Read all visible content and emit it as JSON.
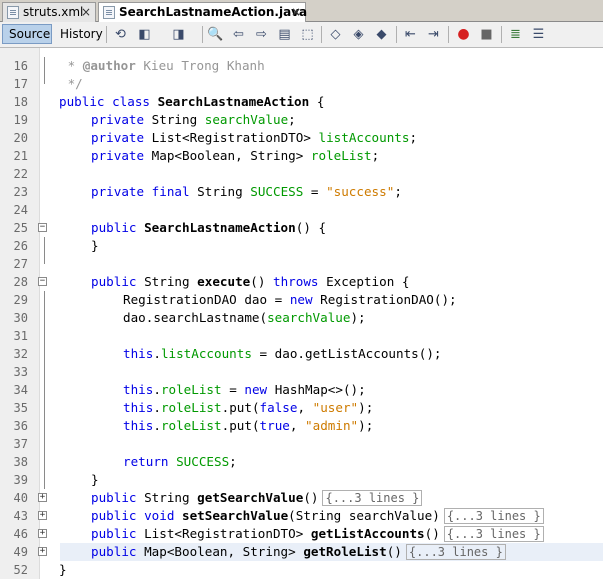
{
  "tabs": [
    {
      "label": "struts.xml",
      "close": "×",
      "active": false
    },
    {
      "label": "SearchLastnameAction.java",
      "close": "×",
      "active": true
    }
  ],
  "toolbar": {
    "source_label": "Source",
    "history_label": "History"
  },
  "colors": {
    "keyword": "#0000e6",
    "field": "#009900",
    "string": "#ce7b00",
    "comment": "#969696",
    "tab_active_bg": "#ffffff",
    "toolbar_active": "#b9d1ea"
  },
  "lines": [
    {
      "n": "16"
    },
    {
      "n": "17"
    },
    {
      "n": "18"
    },
    {
      "n": "19"
    },
    {
      "n": "20"
    },
    {
      "n": "21"
    },
    {
      "n": "22"
    },
    {
      "n": "23"
    },
    {
      "n": "24"
    },
    {
      "n": "25"
    },
    {
      "n": "26"
    },
    {
      "n": "27"
    },
    {
      "n": "28"
    },
    {
      "n": "29"
    },
    {
      "n": "30"
    },
    {
      "n": "31"
    },
    {
      "n": "32"
    },
    {
      "n": "33"
    },
    {
      "n": "34"
    },
    {
      "n": "35"
    },
    {
      "n": "36"
    },
    {
      "n": "37"
    },
    {
      "n": "38"
    },
    {
      "n": "39"
    },
    {
      "n": "40"
    },
    {
      "n": "43"
    },
    {
      "n": "46"
    },
    {
      "n": "49"
    },
    {
      "n": "52"
    }
  ],
  "code": {
    "l16": {
      "a": " * ",
      "b": "@author",
      "c": " Kieu Trong Khanh"
    },
    "l17": " */",
    "l18": {
      "kw": "public class ",
      "name": "SearchLastnameAction",
      "rest": " {"
    },
    "l19": {
      "kw": "private ",
      "type": "String ",
      "fld": "searchValue",
      "rest": ";"
    },
    "l20": {
      "kw": "private ",
      "type": "List<RegistrationDTO> ",
      "fld": "listAccounts",
      "rest": ";"
    },
    "l21": {
      "kw": "private ",
      "type": "Map<Boolean, String> ",
      "fld": "roleList",
      "rest": ";"
    },
    "l23": {
      "kw": "private final ",
      "type": "String ",
      "fld": "SUCCESS",
      "mid": " = ",
      "str": "\"success\"",
      "rest": ";"
    },
    "l25": {
      "kw": "public ",
      "name": "SearchLastnameAction",
      "rest": "() {"
    },
    "l26": "}",
    "l28": {
      "kw": "public ",
      "type": "String ",
      "name": "execute",
      "mid": "() ",
      "kw2": "throws ",
      "rest": "Exception {"
    },
    "l29": {
      "a": "RegistrationDAO dao = ",
      "kw": "new ",
      "rest": "RegistrationDAO();"
    },
    "l30": {
      "a": "dao.searchLastname(",
      "fld": "searchValue",
      "rest": ");"
    },
    "l32": {
      "kw": "this",
      "a": ".",
      "fld": "listAccounts",
      "rest": " = dao.getListAccounts();"
    },
    "l34": {
      "kw": "this",
      "a": ".",
      "fld": "roleList",
      "mid": " = ",
      "kw2": "new ",
      "rest": "HashMap<>();"
    },
    "l35": {
      "kw": "this",
      "a": ".",
      "fld": "roleList",
      "mid": ".put(",
      "kw2": "false",
      "sep": ", ",
      "str": "\"user\"",
      "rest": ");"
    },
    "l36": {
      "kw": "this",
      "a": ".",
      "fld": "roleList",
      "mid": ".put(",
      "kw2": "true",
      "sep": ", ",
      "str": "\"admin\"",
      "rest": ");"
    },
    "l38": {
      "kw": "return ",
      "fld": "SUCCESS",
      "rest": ";"
    },
    "l39": "}",
    "l40": {
      "kw": "public ",
      "type": "String ",
      "name": "getSearchValue",
      "rest": "()",
      "folded": "{...3 lines }"
    },
    "l43": {
      "kw": "public void ",
      "name": "setSearchValue",
      "rest": "(String searchValue)",
      "folded": "{...3 lines }"
    },
    "l46": {
      "kw": "public ",
      "type": "List<RegistrationDTO> ",
      "name": "getListAccounts",
      "rest": "()",
      "folded": "{...3 lines }"
    },
    "l49": {
      "kw": "public ",
      "type": "Map<Boolean, String> ",
      "name": "getRoleList",
      "rest": "()",
      "folded": "{...3 lines }"
    },
    "l52": "}"
  },
  "fold_markers": {
    "minus": "−",
    "plus": "+"
  },
  "icons": [
    "history-back-icon",
    "go-back-icon",
    "go-forward-icon",
    "find-icon",
    "prev-occurrence-icon",
    "next-occurrence-icon",
    "toggle-highlight-icon",
    "toggle-rectangular-icon",
    "prev-bookmark-icon",
    "next-bookmark-icon",
    "toggle-bookmark-icon",
    "shift-left-icon",
    "shift-right-icon",
    "start-macro-icon",
    "stop-macro-icon",
    "comment-icon",
    "uncomment-icon"
  ]
}
